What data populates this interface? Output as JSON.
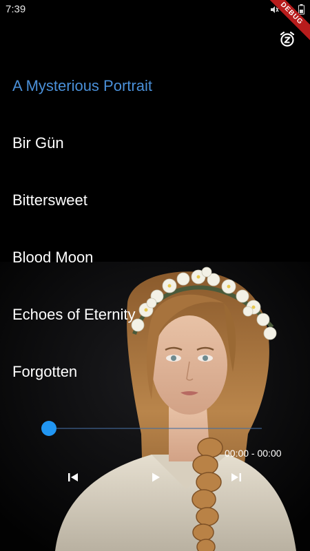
{
  "status_bar": {
    "time": "7:39",
    "debug_label": "DEBUG",
    "icons": [
      "mute-icon",
      "wifi-icon",
      "battery-icon"
    ]
  },
  "toolbar": {
    "sleep_icon": "sleep-timer-icon"
  },
  "songs": [
    {
      "title": "A Mysterious Portrait",
      "active": true
    },
    {
      "title": "Bir Gün",
      "active": false
    },
    {
      "title": "Bittersweet",
      "active": false
    },
    {
      "title": "Blood Moon",
      "active": false
    },
    {
      "title": "Echoes of Eternity",
      "active": false
    },
    {
      "title": "Forgotten",
      "active": false
    }
  ],
  "player": {
    "progress": 0,
    "time_readout": "00:00 - 00:00",
    "controls": [
      "skip-previous-icon",
      "play-icon",
      "skip-next-icon"
    ]
  },
  "colors": {
    "accent": "#4a90d9",
    "seek_thumb": "#2196f3",
    "background": "#000000"
  }
}
